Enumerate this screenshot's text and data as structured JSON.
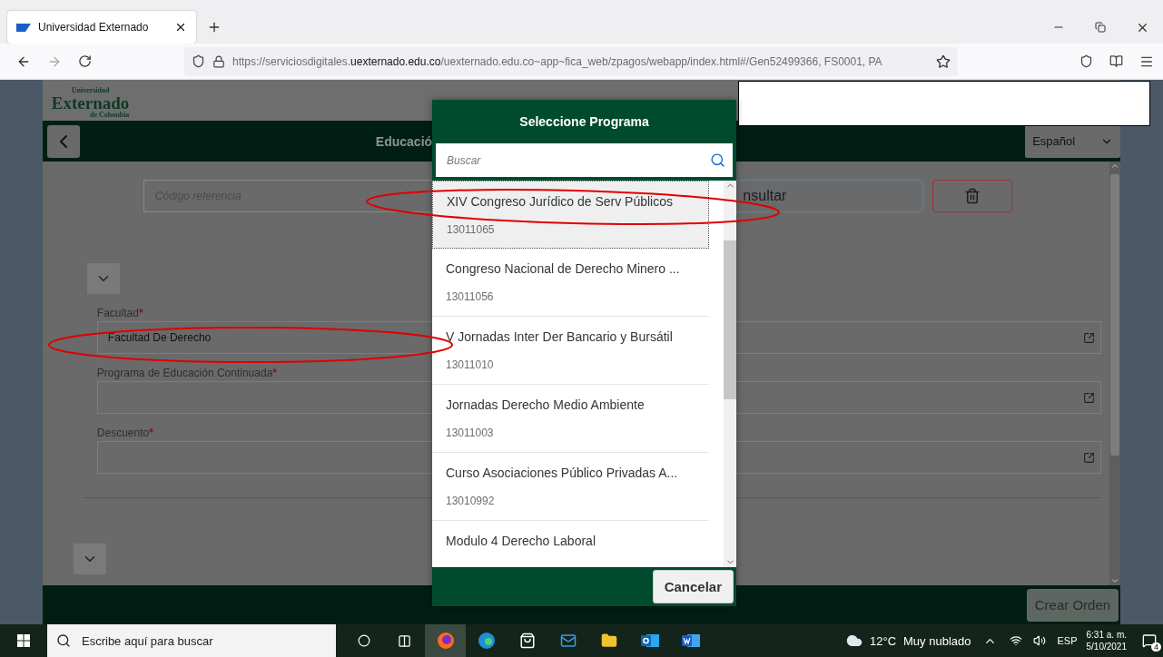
{
  "browser": {
    "tab": {
      "title": "Universidad Externado"
    },
    "url": {
      "prefix": "https://serviciosdigitales.",
      "host": "uexternado.edu.co",
      "path": "/uexternado.edu.co~app~fica_web/zpagos/webapp/index.html#/Gen52499366, FS0001, PA"
    }
  },
  "app": {
    "logo": {
      "top": "Universidad",
      "main": "Externado",
      "bottom": "de Colombia"
    },
    "title": "Educació",
    "language": "Español",
    "reference_field": {
      "placeholder": "Código referencia"
    },
    "consult_button": "nsultar",
    "fields": [
      {
        "label": "Facultad",
        "marker": "*",
        "value": "Facultad De Derecho"
      },
      {
        "label": "Programa de Educación Continuada",
        "marker": "*"
      },
      {
        "label": "Descuento",
        "marker": "*"
      }
    ],
    "create_button": "Crear Orden"
  },
  "dialog": {
    "title": "Seleccione Programa",
    "search": {
      "placeholder": "Buscar"
    },
    "items": [
      {
        "name": "XIV Congreso Jurídico de Serv Públicos",
        "code": "13011065",
        "selected": true
      },
      {
        "name": "Congreso Nacional de Derecho Minero ...",
        "code": "13011056",
        "selected": false
      },
      {
        "name": "V Jornadas Inter Der Bancario y Bursátil",
        "code": "13011010",
        "selected": false
      },
      {
        "name": "Jornadas Derecho Medio Ambiente",
        "code": "13011003",
        "selected": false
      },
      {
        "name": "Curso Asociaciones Público Privadas A...",
        "code": "13010992",
        "selected": false
      },
      {
        "name": "Modulo 4 Derecho Laboral",
        "selected": false
      }
    ],
    "cancel": "Cancelar"
  },
  "taskbar": {
    "search_placeholder": "Escribe aquí para buscar",
    "temperature": "12°C",
    "weather": "Muy nublado",
    "language": "ESP",
    "time": "6:31 a. m.",
    "date": "5/10/2021",
    "notifications": "4"
  }
}
